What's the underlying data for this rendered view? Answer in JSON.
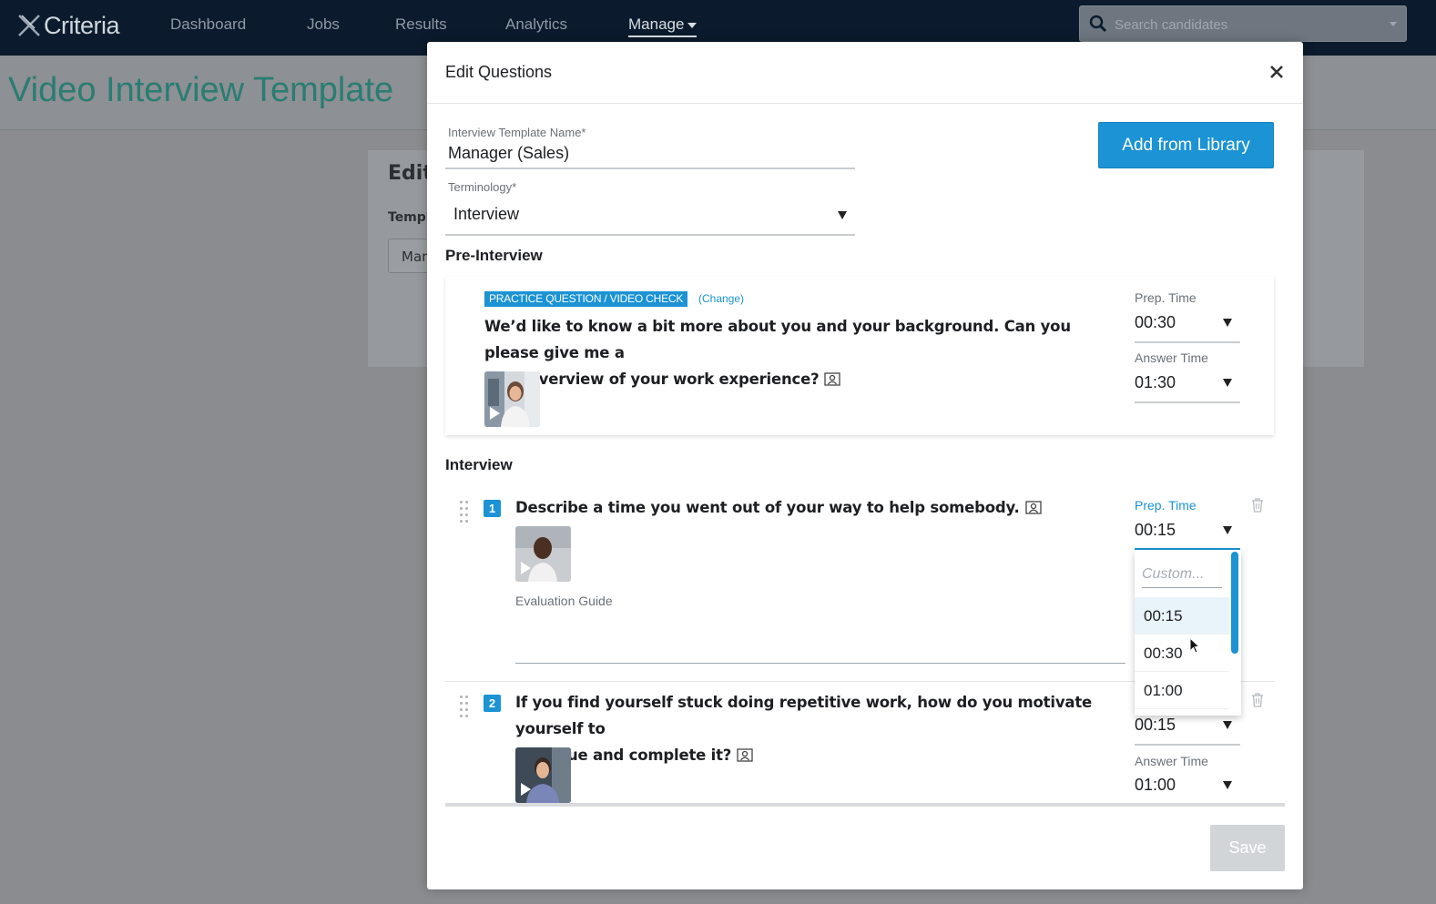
{
  "app": {
    "logo_text": "Criteria",
    "nav": [
      {
        "label": "Dashboard"
      },
      {
        "label": "Jobs"
      },
      {
        "label": "Results"
      },
      {
        "label": "Analytics"
      },
      {
        "label": "Manage"
      }
    ],
    "search_placeholder": "Search candidates"
  },
  "background": {
    "page_title": "Video Interview Template",
    "card_title": "Edit",
    "field_label": "Templ",
    "field_value": "Mar"
  },
  "modal": {
    "title": "Edit Questions",
    "template_name_label": "Interview Template Name*",
    "template_name_value": "Manager (Sales)",
    "terminology_label": "Terminology*",
    "terminology_value": "Interview",
    "add_from_library_label": "Add from Library",
    "pre_interview_heading": "Pre-Interview",
    "interview_heading": "Interview",
    "save_label": "Save"
  },
  "pre_interview": {
    "badge": "PRACTICE QUESTION / VIDEO CHECK",
    "change_label": "(Change)",
    "question_line1": "We’d like to know a bit more about you and your background. Can you please give me a",
    "question_line2": "brief overview of your work experience?",
    "prep_time_label": "Prep. Time",
    "prep_time_value": "00:30",
    "answer_time_label": "Answer Time",
    "answer_time_value": "01:30"
  },
  "questions": [
    {
      "number": "1",
      "text": "Describe a time you went out of your way to help somebody.",
      "evaluation_guide_label": "Evaluation Guide",
      "prep_time_label": "Prep. Time",
      "prep_time_value": "00:15"
    },
    {
      "number": "2",
      "text_line1": "If you find yourself stuck doing repetitive work, how do you motivate yourself to",
      "text_line2": "continue and complete it?",
      "prep_time_value": "00:15",
      "answer_time_label": "Answer Time",
      "answer_time_value": "01:00"
    }
  ],
  "prep_time_dropdown": {
    "custom_placeholder": "Custom...",
    "options": [
      "00:15",
      "00:30",
      "01:00"
    ],
    "selected": "00:15"
  },
  "colors": {
    "accent": "#1b93d4",
    "title_teal": "#2a7d72",
    "nav_bg": "#0b1b2d"
  }
}
